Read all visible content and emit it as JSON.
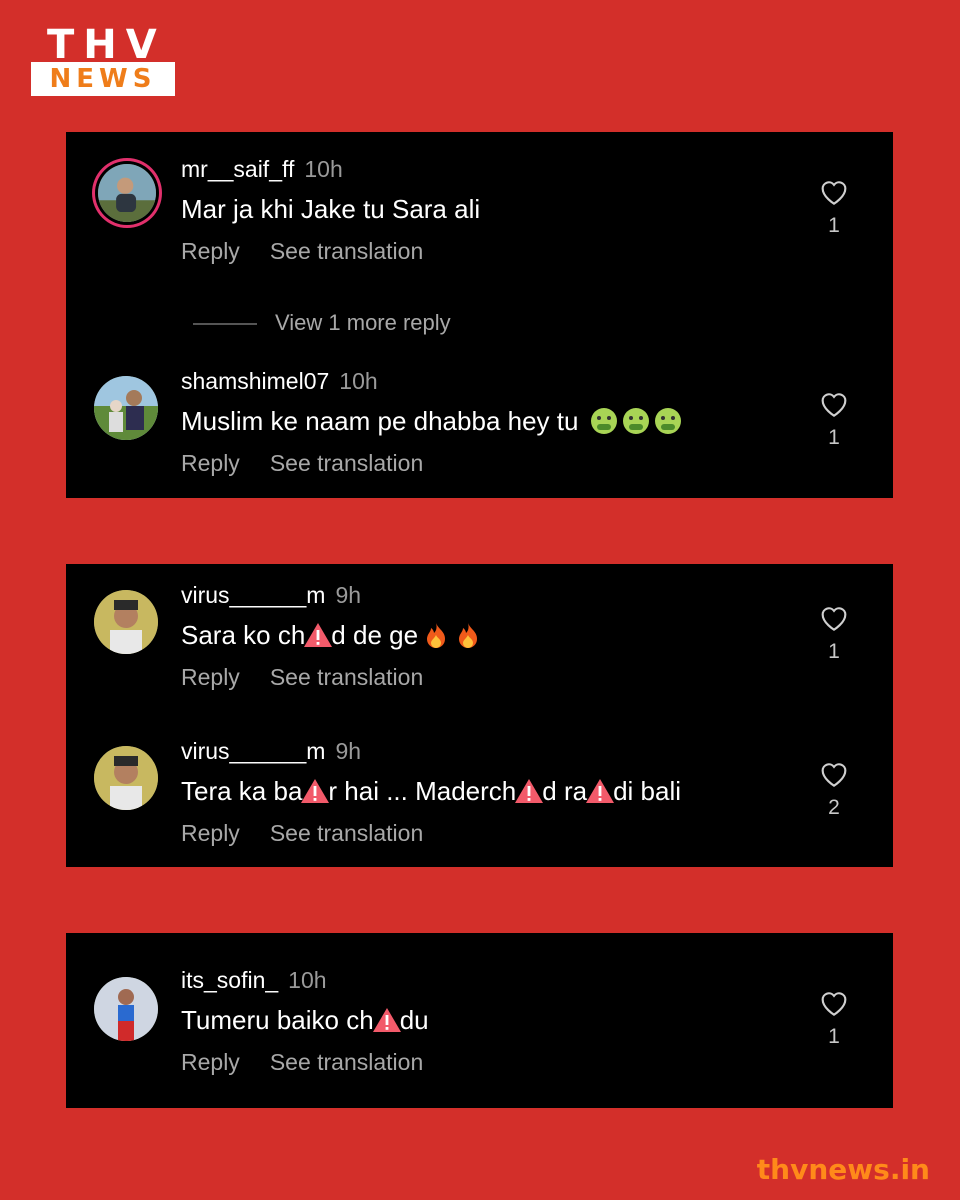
{
  "logo": {
    "top": "THV",
    "bottom": "NEWS"
  },
  "footer": {
    "site": "thvnews.in"
  },
  "actions": {
    "reply": "Reply",
    "translate": "See translation"
  },
  "cards": [
    {
      "comments": [
        {
          "user": "mr__saif_ff",
          "time": "10h",
          "text": "Mar ja khi Jake tu Sara ali",
          "likes": "1"
        },
        {
          "user": "shamshimel07",
          "time": "10h",
          "text": "Muslim ke naam pe dhabba hey tu",
          "likes": "1"
        }
      ],
      "more_replies": "View 1 more reply"
    },
    {
      "comments": [
        {
          "user": "virus______m",
          "time": "9h",
          "text_a": "Sara ko ch",
          "text_b": "d de ge",
          "likes": "1"
        },
        {
          "user": "virus______m",
          "time": "9h",
          "text_a": "Tera ka ba",
          "text_b": "r hai ... Maderch",
          "text_c": "d  ra",
          "text_d": "di bali",
          "likes": "2"
        }
      ]
    },
    {
      "comments": [
        {
          "user": "its_sofin_",
          "time": "10h",
          "text_a": "Tumeru baiko ch",
          "text_b": "du",
          "likes": "1"
        }
      ]
    }
  ],
  "icons": {
    "like": "heart-outline-icon",
    "censor": "warning-triangle-icon",
    "emoji": "nauseated-face-emoji",
    "fire": "fire-emoji"
  }
}
